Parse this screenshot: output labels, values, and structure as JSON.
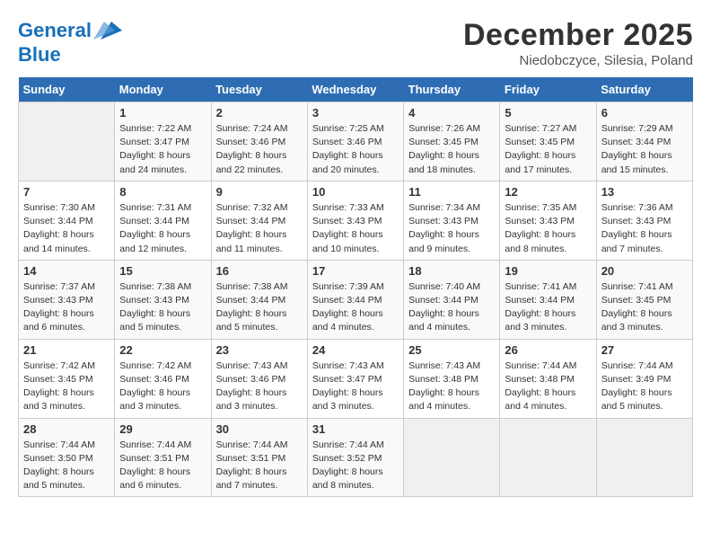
{
  "header": {
    "logo_line1": "General",
    "logo_line2": "Blue",
    "month": "December 2025",
    "location": "Niedobczyce, Silesia, Poland"
  },
  "weekdays": [
    "Sunday",
    "Monday",
    "Tuesday",
    "Wednesday",
    "Thursday",
    "Friday",
    "Saturday"
  ],
  "weeks": [
    [
      {
        "day": "",
        "sunrise": "",
        "sunset": "",
        "daylight": ""
      },
      {
        "day": "1",
        "sunrise": "Sunrise: 7:22 AM",
        "sunset": "Sunset: 3:47 PM",
        "daylight": "Daylight: 8 hours and 24 minutes."
      },
      {
        "day": "2",
        "sunrise": "Sunrise: 7:24 AM",
        "sunset": "Sunset: 3:46 PM",
        "daylight": "Daylight: 8 hours and 22 minutes."
      },
      {
        "day": "3",
        "sunrise": "Sunrise: 7:25 AM",
        "sunset": "Sunset: 3:46 PM",
        "daylight": "Daylight: 8 hours and 20 minutes."
      },
      {
        "day": "4",
        "sunrise": "Sunrise: 7:26 AM",
        "sunset": "Sunset: 3:45 PM",
        "daylight": "Daylight: 8 hours and 18 minutes."
      },
      {
        "day": "5",
        "sunrise": "Sunrise: 7:27 AM",
        "sunset": "Sunset: 3:45 PM",
        "daylight": "Daylight: 8 hours and 17 minutes."
      },
      {
        "day": "6",
        "sunrise": "Sunrise: 7:29 AM",
        "sunset": "Sunset: 3:44 PM",
        "daylight": "Daylight: 8 hours and 15 minutes."
      }
    ],
    [
      {
        "day": "7",
        "sunrise": "Sunrise: 7:30 AM",
        "sunset": "Sunset: 3:44 PM",
        "daylight": "Daylight: 8 hours and 14 minutes."
      },
      {
        "day": "8",
        "sunrise": "Sunrise: 7:31 AM",
        "sunset": "Sunset: 3:44 PM",
        "daylight": "Daylight: 8 hours and 12 minutes."
      },
      {
        "day": "9",
        "sunrise": "Sunrise: 7:32 AM",
        "sunset": "Sunset: 3:44 PM",
        "daylight": "Daylight: 8 hours and 11 minutes."
      },
      {
        "day": "10",
        "sunrise": "Sunrise: 7:33 AM",
        "sunset": "Sunset: 3:43 PM",
        "daylight": "Daylight: 8 hours and 10 minutes."
      },
      {
        "day": "11",
        "sunrise": "Sunrise: 7:34 AM",
        "sunset": "Sunset: 3:43 PM",
        "daylight": "Daylight: 8 hours and 9 minutes."
      },
      {
        "day": "12",
        "sunrise": "Sunrise: 7:35 AM",
        "sunset": "Sunset: 3:43 PM",
        "daylight": "Daylight: 8 hours and 8 minutes."
      },
      {
        "day": "13",
        "sunrise": "Sunrise: 7:36 AM",
        "sunset": "Sunset: 3:43 PM",
        "daylight": "Daylight: 8 hours and 7 minutes."
      }
    ],
    [
      {
        "day": "14",
        "sunrise": "Sunrise: 7:37 AM",
        "sunset": "Sunset: 3:43 PM",
        "daylight": "Daylight: 8 hours and 6 minutes."
      },
      {
        "day": "15",
        "sunrise": "Sunrise: 7:38 AM",
        "sunset": "Sunset: 3:43 PM",
        "daylight": "Daylight: 8 hours and 5 minutes."
      },
      {
        "day": "16",
        "sunrise": "Sunrise: 7:38 AM",
        "sunset": "Sunset: 3:44 PM",
        "daylight": "Daylight: 8 hours and 5 minutes."
      },
      {
        "day": "17",
        "sunrise": "Sunrise: 7:39 AM",
        "sunset": "Sunset: 3:44 PM",
        "daylight": "Daylight: 8 hours and 4 minutes."
      },
      {
        "day": "18",
        "sunrise": "Sunrise: 7:40 AM",
        "sunset": "Sunset: 3:44 PM",
        "daylight": "Daylight: 8 hours and 4 minutes."
      },
      {
        "day": "19",
        "sunrise": "Sunrise: 7:41 AM",
        "sunset": "Sunset: 3:44 PM",
        "daylight": "Daylight: 8 hours and 3 minutes."
      },
      {
        "day": "20",
        "sunrise": "Sunrise: 7:41 AM",
        "sunset": "Sunset: 3:45 PM",
        "daylight": "Daylight: 8 hours and 3 minutes."
      }
    ],
    [
      {
        "day": "21",
        "sunrise": "Sunrise: 7:42 AM",
        "sunset": "Sunset: 3:45 PM",
        "daylight": "Daylight: 8 hours and 3 minutes."
      },
      {
        "day": "22",
        "sunrise": "Sunrise: 7:42 AM",
        "sunset": "Sunset: 3:46 PM",
        "daylight": "Daylight: 8 hours and 3 minutes."
      },
      {
        "day": "23",
        "sunrise": "Sunrise: 7:43 AM",
        "sunset": "Sunset: 3:46 PM",
        "daylight": "Daylight: 8 hours and 3 minutes."
      },
      {
        "day": "24",
        "sunrise": "Sunrise: 7:43 AM",
        "sunset": "Sunset: 3:47 PM",
        "daylight": "Daylight: 8 hours and 3 minutes."
      },
      {
        "day": "25",
        "sunrise": "Sunrise: 7:43 AM",
        "sunset": "Sunset: 3:48 PM",
        "daylight": "Daylight: 8 hours and 4 minutes."
      },
      {
        "day": "26",
        "sunrise": "Sunrise: 7:44 AM",
        "sunset": "Sunset: 3:48 PM",
        "daylight": "Daylight: 8 hours and 4 minutes."
      },
      {
        "day": "27",
        "sunrise": "Sunrise: 7:44 AM",
        "sunset": "Sunset: 3:49 PM",
        "daylight": "Daylight: 8 hours and 5 minutes."
      }
    ],
    [
      {
        "day": "28",
        "sunrise": "Sunrise: 7:44 AM",
        "sunset": "Sunset: 3:50 PM",
        "daylight": "Daylight: 8 hours and 5 minutes."
      },
      {
        "day": "29",
        "sunrise": "Sunrise: 7:44 AM",
        "sunset": "Sunset: 3:51 PM",
        "daylight": "Daylight: 8 hours and 6 minutes."
      },
      {
        "day": "30",
        "sunrise": "Sunrise: 7:44 AM",
        "sunset": "Sunset: 3:51 PM",
        "daylight": "Daylight: 8 hours and 7 minutes."
      },
      {
        "day": "31",
        "sunrise": "Sunrise: 7:44 AM",
        "sunset": "Sunset: 3:52 PM",
        "daylight": "Daylight: 8 hours and 8 minutes."
      },
      {
        "day": "",
        "sunrise": "",
        "sunset": "",
        "daylight": ""
      },
      {
        "day": "",
        "sunrise": "",
        "sunset": "",
        "daylight": ""
      },
      {
        "day": "",
        "sunrise": "",
        "sunset": "",
        "daylight": ""
      }
    ]
  ]
}
